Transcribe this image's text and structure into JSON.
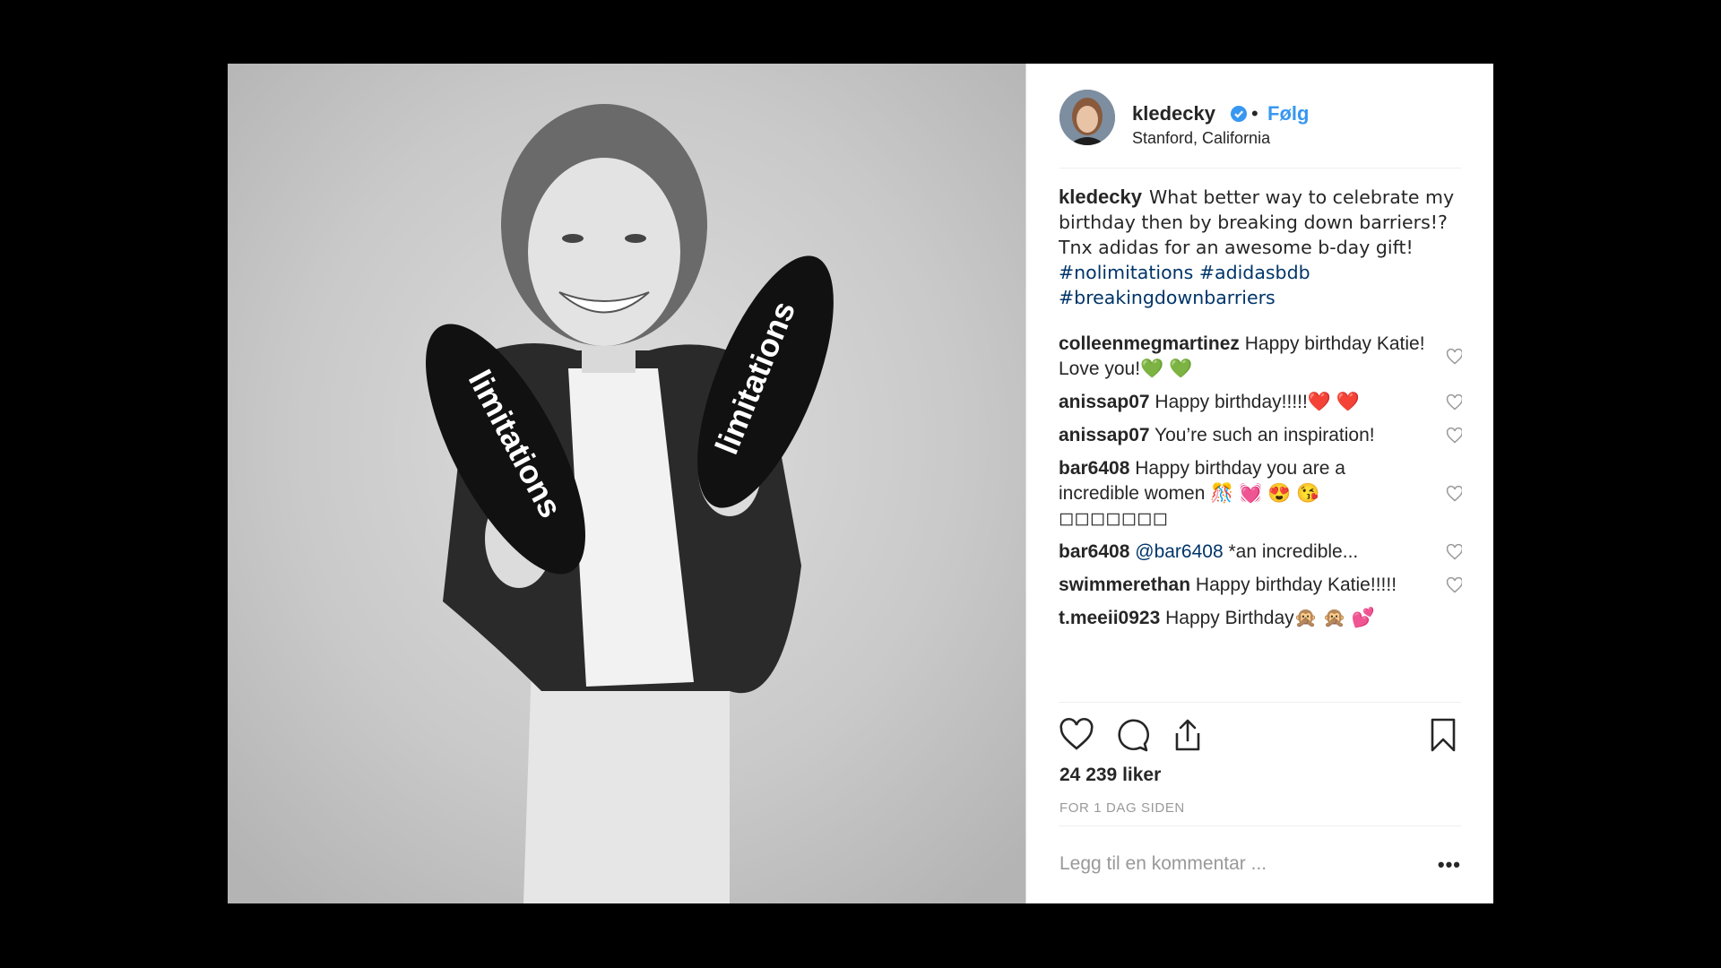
{
  "header": {
    "username": "kledecky",
    "separator": "•",
    "follow_label": "Følg",
    "location": "Stanford, California"
  },
  "photo": {
    "sole_text_left": "limitations",
    "sole_text_right": "limitations"
  },
  "caption": {
    "username": "kledecky",
    "line1": "What better way to celebrate my birthday then by breaking down barriers!?",
    "line2": "Tnx adidas for an awesome b-day gift!",
    "hashtags": [
      "#nolimitations",
      "#adidasbdb",
      "#breakingdownbarriers"
    ]
  },
  "comments": [
    {
      "user": "colleenmegmartinez",
      "text": "Happy birthday Katie! Love you!💚 💚"
    },
    {
      "user": "anissap07",
      "text": "Happy birthday!!!!!❤️ ❤️"
    },
    {
      "user": "anissap07",
      "text": "You’re such an inspiration!"
    },
    {
      "user": "bar6408",
      "text": "Happy birthday you are a incredible women 🎊 💓 😍 😘 ◻◻◻◻◻◻◻"
    },
    {
      "user": "bar6408",
      "mention": "@bar6408",
      "text": "*an incredible..."
    },
    {
      "user": "swimmerethan",
      "text": "Happy birthday Katie!!!!!"
    },
    {
      "user": "t.meeii0923",
      "text": "Happy Birthday🙊 🙊 💕"
    }
  ],
  "likes": "24 239 liker",
  "time": "FOR 1 DAG SIDEN",
  "add_comment": {
    "placeholder": "Legg til en kommentar ...",
    "more": "•••"
  },
  "colors": {
    "link": "#3897f0",
    "hashtag": "#003569",
    "text": "#262626",
    "muted": "#999999"
  }
}
